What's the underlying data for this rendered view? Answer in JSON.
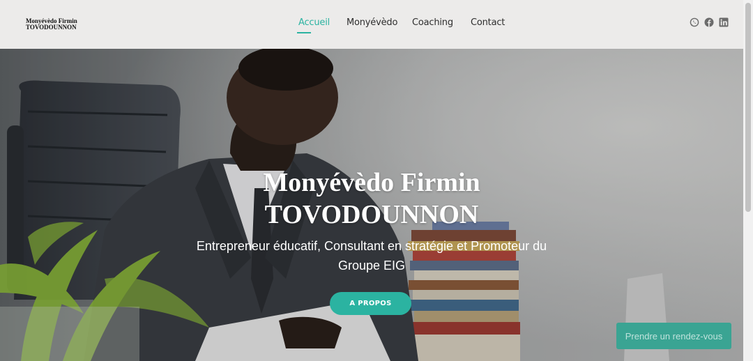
{
  "logo": {
    "line1": "Monyévèdo Firmin",
    "line2": "TOVODOUNNON"
  },
  "nav": {
    "items": [
      {
        "label": "Accueil"
      },
      {
        "label": "Monyévèdo"
      },
      {
        "label": "Coaching"
      },
      {
        "label": "Contact"
      }
    ],
    "active": "Accueil"
  },
  "social": [
    {
      "icon": "whatsapp-icon"
    },
    {
      "icon": "facebook-icon"
    },
    {
      "icon": "linkedin-icon"
    }
  ],
  "hero": {
    "title_line1": "Monyévèdo Firmin",
    "title_line2": "TOVODOUNNON",
    "subtitle_line1": "Entrepreneur éducatif, Consultant en stratégie et Promoteur du",
    "subtitle_line2": "Groupe EIG",
    "cta_label": "A PROPOS"
  },
  "appointment": {
    "label": "Prendre un rendez-vous"
  },
  "colors": {
    "accent": "#2bb3a1",
    "header_bg": "#ecebea",
    "appointment_bg": "#3aa493"
  }
}
